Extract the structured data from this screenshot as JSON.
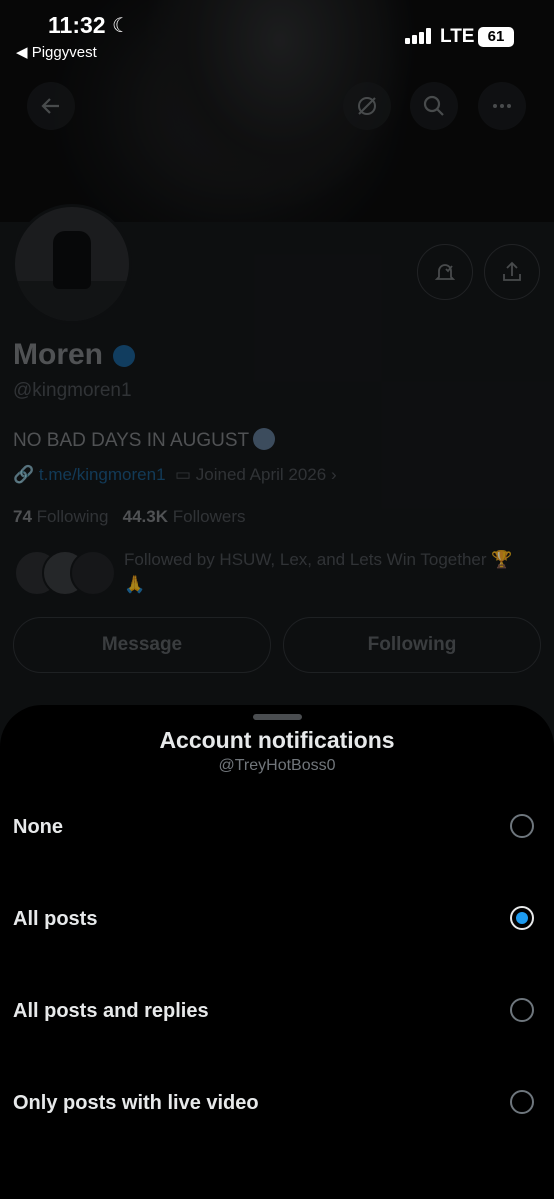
{
  "status_bar": {
    "time": "11:32",
    "back_app": "◀ Piggyvest",
    "network": "LTE",
    "battery": "61"
  },
  "profile": {
    "name": "Moren",
    "handle": "@kingmoren1",
    "bio": "NO BAD DAYS IN AUGUST",
    "link": "t.me/kingmoren1",
    "joined": "Joined April 2026",
    "following_count": "74",
    "following_label": "Following",
    "followers_count": "44.3K",
    "followers_label": "Followers",
    "followed_by": "Followed by HSUW, Lex, and Lets Win Together 🏆 🙏",
    "message_button": "Message",
    "following_button": "Following"
  },
  "sheet": {
    "title": "Account notifications",
    "subtitle": "@TreyHotBoss0",
    "options": [
      {
        "label": "None",
        "selected": false
      },
      {
        "label": "All posts",
        "selected": true
      },
      {
        "label": "All posts and replies",
        "selected": false
      },
      {
        "label": "Only posts with live video",
        "selected": false
      }
    ]
  },
  "colors": {
    "accent": "#1d9bf0",
    "sheet_background": "#000000",
    "profile_background": "#15171a"
  }
}
